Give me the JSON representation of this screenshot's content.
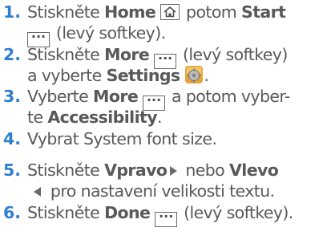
{
  "steps": [
    {
      "number": "1.",
      "lines": [
        {
          "t1": "Stiskněte ",
          "b1": "Home",
          "t2": " potom ",
          "b2": "Start"
        },
        {
          "t1": " (levý softkey)."
        }
      ]
    },
    {
      "number": "2.",
      "lines": [
        {
          "t1": "Stiskněte ",
          "b1": "More",
          "t2": " (levý softkey)"
        },
        {
          "t1": "a vyberte ",
          "b1": "Settings",
          "t2": "."
        }
      ]
    },
    {
      "number": "3.",
      "lines": [
        {
          "t1": "Vyberte ",
          "b1": "More",
          "t2": " a potom vyber-"
        },
        {
          "t1": "te ",
          "b1": "Accessibility",
          "t2": "."
        }
      ]
    },
    {
      "number": "4.",
      "lines": [
        {
          "t1": "Vybrat System font size."
        }
      ]
    },
    {
      "number": "5.",
      "lines": [
        {
          "t1": "Stiskněte ",
          "b1": "Vpravo",
          "t2": " nebo ",
          "b2": "Vlevo"
        },
        {
          "t1": " pro nastavení velikosti textu."
        }
      ]
    },
    {
      "number": "6.",
      "lines": [
        {
          "t1": "Stiskněte ",
          "b1": "Done",
          "t2": " (levý softkey)."
        }
      ]
    }
  ],
  "icons": {
    "softkey": "softkey-dots-icon",
    "home": "home-key-icon",
    "settings": "settings-app-icon",
    "right": "right-arrow-icon",
    "left": "left-arrow-icon"
  },
  "colors": {
    "number": "#2e7fcf",
    "text": "#595959"
  }
}
